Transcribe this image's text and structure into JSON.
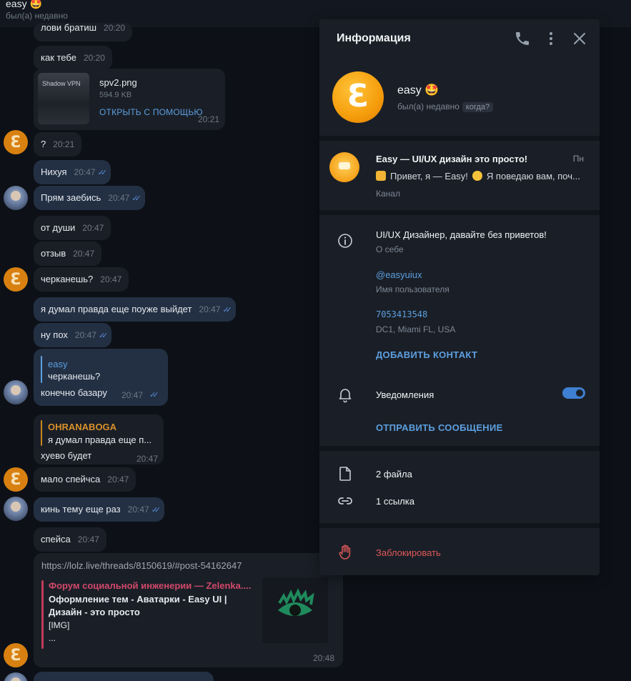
{
  "header": {
    "name": "easy 🤩",
    "status": "был(а) недавно"
  },
  "messages": {
    "m1_text": "лови братиш",
    "m1_time": "20:20",
    "m2_text": "как тебе",
    "m2_time": "20:20",
    "file": {
      "thumb_label": "Shadow VPN",
      "name": "spv2.png",
      "size": "594.9 KB",
      "open": "ОТКРЫТЬ С ПОМОЩЬЮ",
      "time": "20:21"
    },
    "m3_text": "?",
    "m3_time": "20:21",
    "m4_text": "Нихуя",
    "m4_time": "20:47",
    "m5_text": "Прям заебись",
    "m5_time": "20:47",
    "m6_text": "от души",
    "m6_time": "20:47",
    "m7_text": "отзыв",
    "m7_time": "20:47",
    "m8_text": "черканешь?",
    "m8_time": "20:47",
    "m9_text": "я думал правда еще поуже выйдет",
    "m9_time": "20:47",
    "m10_text": "ну пох",
    "m10_time": "20:47",
    "m11": {
      "reply_name": "easy",
      "reply_text": "черканешь?",
      "text": "конечно базару",
      "time": "20:47"
    },
    "m12": {
      "reply_name": "OHRANABOGA",
      "reply_text": "я думал правда еще п...",
      "text": "хуево будет",
      "time": "20:47"
    },
    "m13_text": "мало спейчса",
    "m13_time": "20:47",
    "m14_text": "кинь тему еще раз",
    "m14_time": "20:47",
    "m15_text": "спейса",
    "m15_time": "20:47",
    "link": {
      "url": "https://lolz.live/threads/8150619/#post-54162647",
      "site": "Форум социальной инженерии — Zelenka....",
      "title": "Оформление тем - Аватарки - Easy UI | Дизайн - это просто",
      "img": "[IMG]",
      "more": "...",
      "time": "20:48"
    }
  },
  "avatars": {
    "easy_letter": "Ɛ"
  },
  "panel": {
    "title": "Информация",
    "profile_name": "easy 🤩",
    "profile_status": "был(а) недавно",
    "when_chip": "когда?",
    "channel": {
      "name": "Easy — UI/UX дизайн это просто!",
      "day": "Пн",
      "preview_a": "Привет, я — Easy!",
      "preview_b": "Я поведаю вам, поч...",
      "type": "Канал"
    },
    "bio": "UI/UX Дизайнер, давайте без приветов!",
    "bio_label": "О себе",
    "username": "@easyuiux",
    "username_label": "Имя пользователя",
    "phone": "7053413548",
    "phone_label": "DC1, Miami FL, USA",
    "add_contact": "ДОБАВИТЬ КОНТАКТ",
    "notifications": "Уведомления",
    "notifications_on": true,
    "send_message": "ОТПРАВИТЬ СООБЩЕНИЕ",
    "files": "2 файла",
    "links": "1 ссылка",
    "block": "Заблокировать"
  },
  "colors": {
    "accent": "#5d9fe0",
    "danger": "#e05858",
    "panel_bg": "#1a1f27",
    "out_bubble": "#233044",
    "in_bubble": "#1a1f27"
  }
}
